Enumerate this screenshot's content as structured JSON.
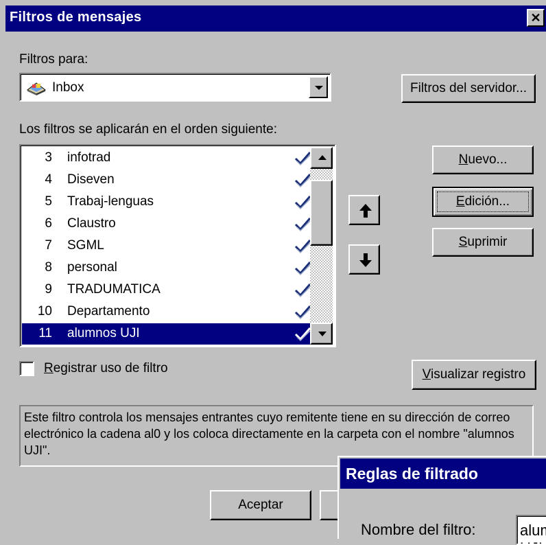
{
  "window": {
    "title": "Filtros de mensajes",
    "close_symbol": "✕"
  },
  "filters_for": {
    "label": "Filtros para:",
    "selected_folder": "Inbox",
    "folder_icon": "inbox-icon"
  },
  "server_filters_button": "Filtros del servidor...",
  "order_label": "Los filtros se aplicarán en el orden siguiente:",
  "filters": [
    {
      "num": "3",
      "name": "infotrad",
      "enabled": true
    },
    {
      "num": "4",
      "name": "Diseven",
      "enabled": true
    },
    {
      "num": "5",
      "name": "Trabaj-lenguas",
      "enabled": true
    },
    {
      "num": "6",
      "name": "Claustro",
      "enabled": true
    },
    {
      "num": "7",
      "name": "SGML",
      "enabled": true
    },
    {
      "num": "8",
      "name": "personal",
      "enabled": true
    },
    {
      "num": "9",
      "name": "TRADUMATICA",
      "enabled": true
    },
    {
      "num": "10",
      "name": "Departamento",
      "enabled": true
    },
    {
      "num": "11",
      "name": "alumnos UJI",
      "enabled": true,
      "selected": true
    }
  ],
  "buttons": {
    "nuevo_mnemonic": "N",
    "nuevo_rest": "uevo...",
    "edicion_mnemonic": "E",
    "edicion_rest": "dición...",
    "suprimir_mnemonic": "S",
    "suprimir_rest": "uprimir",
    "visualizar_mnemonic": "V",
    "visualizar_rest": "isualizar registro",
    "aceptar": "Aceptar"
  },
  "log_checkbox": {
    "mnemonic": "R",
    "rest": "egistrar uso de filtro",
    "checked": false
  },
  "description": "Este filtro controla los mensajes entrantes cuyo remitente tiene en su dirección de correo electrónico la cadena al0 y los coloca directamente en la carpeta con el nombre \"alumnos UJI\".",
  "rules_window": {
    "title": "Reglas de filtrado",
    "name_label": "Nombre del filtro:",
    "name_value": "alumnos UJI"
  },
  "colors": {
    "title_bar": "#000080",
    "face": "#c0c0c0",
    "selection": "#000080",
    "check": "#1c2f7a"
  }
}
